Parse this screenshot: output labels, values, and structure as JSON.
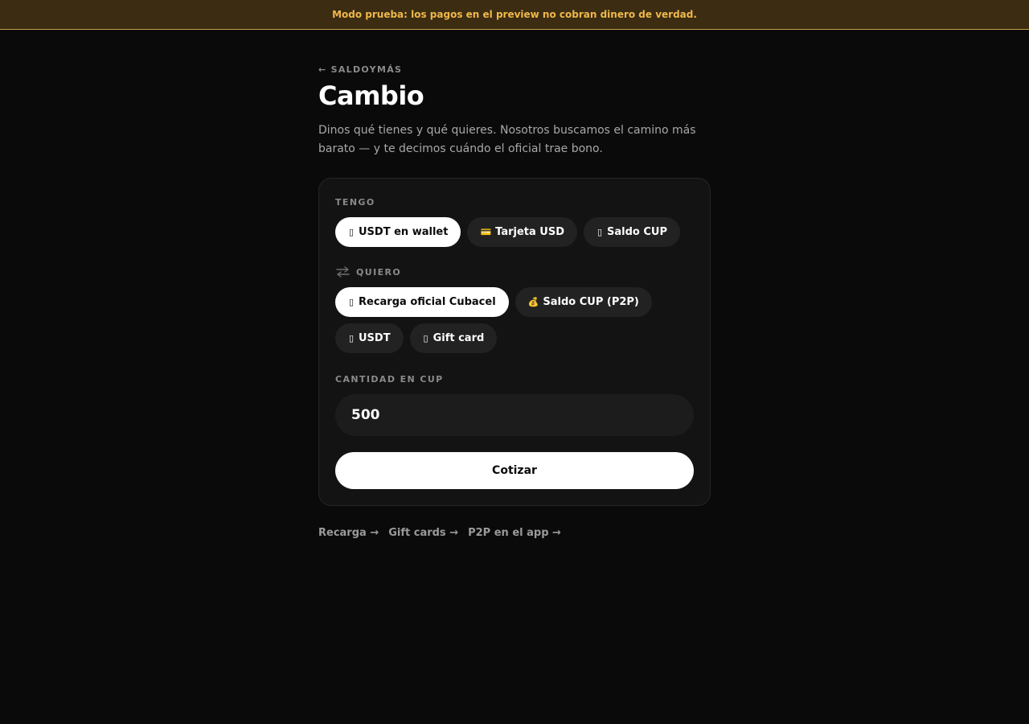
{
  "banner": {
    "text": "Modo prueba: los pagos en el preview no cobran dinero de verdad."
  },
  "header": {
    "back_label": "← SALDOYMÁS",
    "title": "Cambio",
    "subtitle": "Dinos qué tienes y qué quieres. Nosotros buscamos el camino más barato — y te decimos cuándo el oficial trae bono."
  },
  "form": {
    "tengo": {
      "label": "TENGO",
      "options": [
        {
          "icon": "▯",
          "icon_name": "wallet-icon",
          "label": "USDT en wallet",
          "selected": true
        },
        {
          "icon": "💳",
          "icon_name": "card-icon",
          "label": "Tarjeta USD",
          "selected": false
        },
        {
          "icon": "▯",
          "icon_name": "phone-icon",
          "label": "Saldo CUP",
          "selected": false
        }
      ]
    },
    "quiero": {
      "label": "QUIERO",
      "icon_name": "swap-icon",
      "options": [
        {
          "icon": "▯",
          "icon_name": "phone-icon",
          "label": "Recarga oficial Cubacel",
          "selected": true
        },
        {
          "icon": "💰",
          "icon_name": "money-bag-icon",
          "label": "Saldo CUP (P2P)",
          "selected": false
        },
        {
          "icon": "▯",
          "icon_name": "coin-icon",
          "label": "USDT",
          "selected": false
        },
        {
          "icon": "▯",
          "icon_name": "gift-icon",
          "label": "Gift card",
          "selected": false
        }
      ]
    },
    "cantidad": {
      "label": "CANTIDAD EN CUP",
      "value": "500"
    },
    "submit_label": "Cotizar"
  },
  "footer_links": [
    {
      "label": "Recarga →"
    },
    {
      "label": "Gift cards →"
    },
    {
      "label": "P2P en el app →"
    }
  ],
  "colors": {
    "background": "#0a0a0a",
    "banner_bg": "#3b2c12",
    "banner_text": "#f0b84a",
    "card_bg": "#131313",
    "chip_bg": "#222222",
    "active_chip_bg": "#ffffff"
  }
}
